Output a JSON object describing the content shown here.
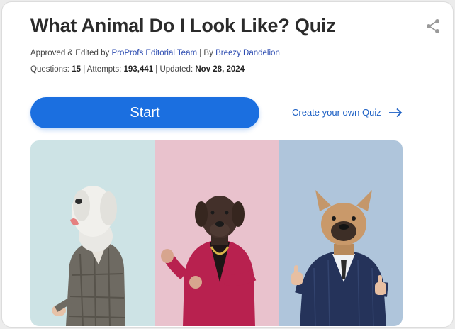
{
  "quiz": {
    "title": "What Animal Do I Look Like? Quiz",
    "approved_prefix": "Approved & Edited by",
    "editor": "ProProfs Editorial Team",
    "author_separator": "| By",
    "author": "Breezy Dandelion",
    "questions_label": "Questions:",
    "questions_value": "15",
    "attempts_label": "| Attempts:",
    "attempts_value": "193,441",
    "updated_label": "| Updated:",
    "updated_value": "Nov 28, 2024"
  },
  "actions": {
    "start_label": "Start",
    "create_label": "Create your own Quiz"
  },
  "image": {
    "panels": [
      {
        "name": "sheepdog-in-tweed-jacket",
        "background": "#cde3e5"
      },
      {
        "name": "labrador-in-magenta-suit",
        "background": "#e9c2cd"
      },
      {
        "name": "french-bulldog-in-navy-suit",
        "background": "#afc5db"
      }
    ]
  },
  "colors": {
    "primary": "#1b6fe0",
    "link": "#2b4bb0",
    "title": "#2b2b2b"
  },
  "icons": {
    "share": "share-icon",
    "arrow": "arrow-right-icon"
  }
}
